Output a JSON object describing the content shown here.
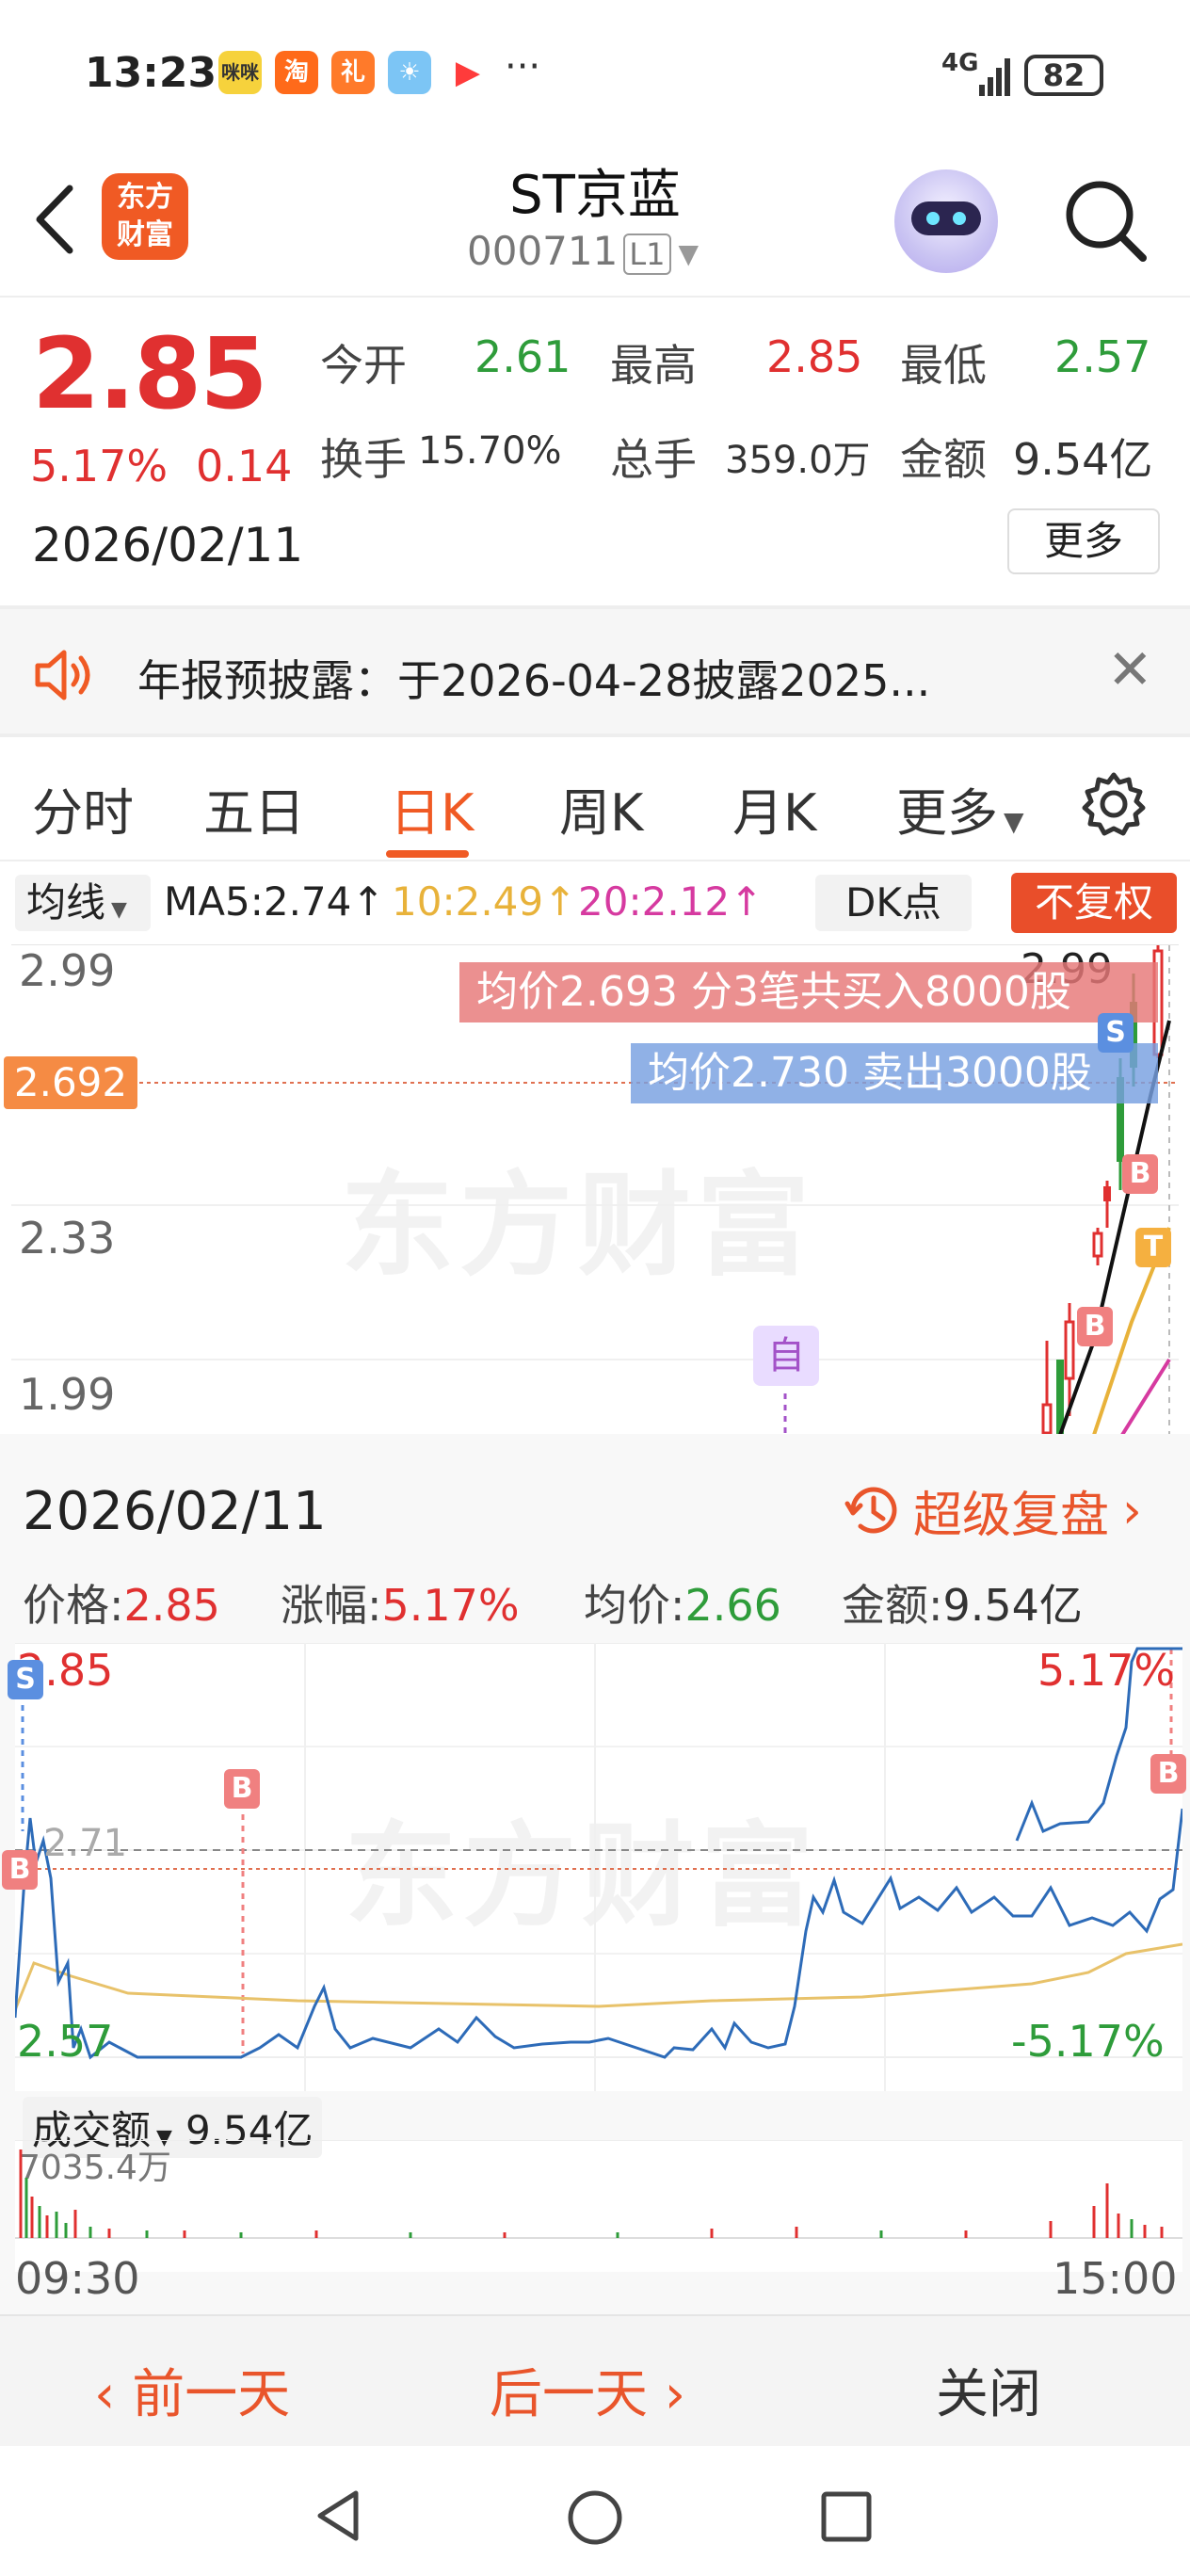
{
  "status_bar": {
    "time": "13:23",
    "apps": [
      {
        "icon": "mimi-app-icon",
        "label": "咪咪",
        "color": "#f6d23c"
      },
      {
        "icon": "taobao-icon",
        "label": "淘",
        "color": "#ff6a1a"
      },
      {
        "icon": "gift-app-icon",
        "label": "礼",
        "color": "#ff7a2a"
      },
      {
        "icon": "weather-icon",
        "label": "☀",
        "color": "#7cc5f5"
      },
      {
        "icon": "video-app-icon",
        "label": "▶",
        "color": "#ff3b3b"
      }
    ],
    "more": "···",
    "network": "4G",
    "battery": "82"
  },
  "header": {
    "logo_line1": "东方",
    "logo_line2": "财富",
    "title": "ST京蓝",
    "code": "000711",
    "level": "L1"
  },
  "quote": {
    "price": "2.85",
    "change_pct": "5.17%",
    "change_amt": "0.14",
    "open_label": "今开",
    "open": "2.61",
    "high_label": "最高",
    "high": "2.85",
    "low_label": "最低",
    "low": "2.57",
    "turnover_label": "换手",
    "turnover": "15.70%",
    "volume_label": "总手",
    "volume": "359.0万",
    "amount_label": "金额",
    "amount": "9.54亿",
    "date": "2026/02/11",
    "more_label": "更多"
  },
  "notice": {
    "text": "年报预披露：于2026-04-28披露2025..."
  },
  "tabs": [
    "分时",
    "五日",
    "日K",
    "周K",
    "月K",
    "更多"
  ],
  "active_tab": "日K",
  "ma_row": {
    "selector": "均线",
    "ma5": "MA5:2.74↑",
    "ma10": "10:2.49↑",
    "ma20": "20:2.12↑",
    "dk": "DK点",
    "adjust": "不复权"
  },
  "colors": {
    "accent": "#f05a24",
    "up": "#e03030",
    "down": "#2e9c3a",
    "ma10": "#e8b23a",
    "ma20": "#d63aa0"
  },
  "kline": {
    "ticks": [
      "2.99",
      "2.33",
      "1.99"
    ],
    "current_badge": "2.692",
    "top_price": "2.99",
    "buy_bubble": "均价2.693  分3笔共买入8000股",
    "sell_bubble": "均价2.730  卖出3000股",
    "self_tag": "自",
    "marks": [
      "S",
      "B",
      "B",
      "T"
    ],
    "watermark": "东方财富"
  },
  "intraday": {
    "date": "2026/02/11",
    "replay": "超级复盘",
    "price_label": "价格:",
    "price": "2.85",
    "pct_label": "涨幅:",
    "pct": "5.17%",
    "avg_label": "均价:",
    "avg": "2.66",
    "amount_label": "金额:",
    "amount": "9.54亿",
    "top_tick": "2.85",
    "mid_tick": "2.71",
    "bottom_tick": "2.57",
    "top_pct": "5.17%",
    "bottom_pct": "-5.17%",
    "marks": [
      "S",
      "B",
      "B",
      "B"
    ],
    "volume_selector": "成交额",
    "volume_total": "9.54亿",
    "volume_max": "7035.4万",
    "time_start": "09:30",
    "time_end": "15:00"
  },
  "bottom_nav": {
    "prev": "前一天",
    "next": "后一天",
    "close": "关闭"
  }
}
